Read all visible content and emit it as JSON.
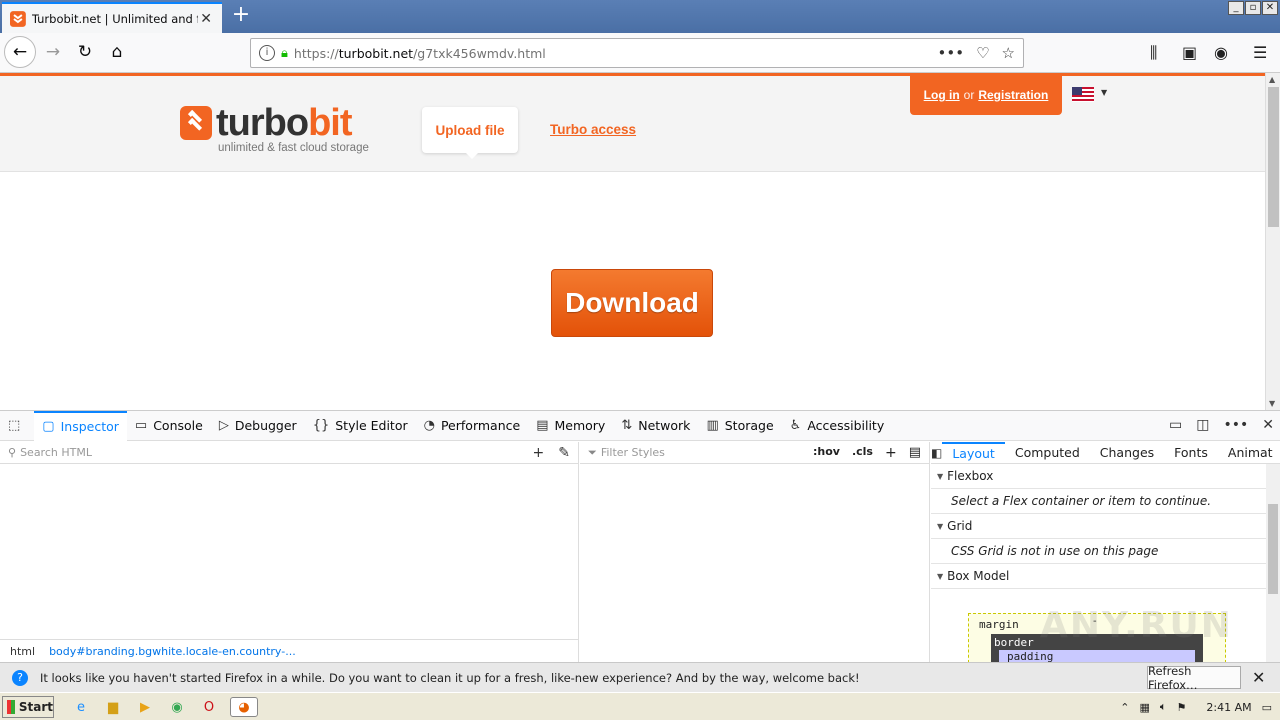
{
  "browser": {
    "tab_title": "Turbobit.net | Unlimited and fast fi",
    "url_prefix": "https://",
    "url_domain": "turbobit.net",
    "url_path": "/g7txk456wmdv.html",
    "window_controls": [
      "_",
      "▫",
      "X"
    ]
  },
  "page": {
    "logo_turbo": "turbo",
    "logo_bit": "bit",
    "tagline": "unlimited & fast cloud storage",
    "upload_label": "Upload file",
    "turbo_access_label": "Turbo access",
    "login_label": "Log in",
    "or_label": "or",
    "register_label": "Registration",
    "download_label": "Download"
  },
  "devtools": {
    "tabs": [
      "Inspector",
      "Console",
      "Debugger",
      "Style Editor",
      "Performance",
      "Memory",
      "Network",
      "Storage",
      "Accessibility"
    ],
    "search_html_placeholder": "Search HTML",
    "filter_styles_placeholder": "Filter Styles",
    "hov": ":hov",
    "cls": ".cls",
    "breadcrumb_root": "html",
    "breadcrumb_node": "body#branding.bgwhite.locale-en.country-...",
    "right_tabs": [
      "Layout",
      "Computed",
      "Changes",
      "Fonts",
      "Animat"
    ],
    "flexbox_title": "Flexbox",
    "flexbox_msg": "Select a Flex container or item to continue.",
    "grid_title": "Grid",
    "grid_msg": "CSS Grid is not in use on this page",
    "boxmodel_title": "Box Model",
    "bm_margin": "margin",
    "bm_border": "border",
    "bm_padding": "padding",
    "bm_dash": "-"
  },
  "notification": {
    "message": "It looks like you haven't started Firefox in a while. Do you want to clean it up for a fresh, like-new experience? And by the way, welcome back!",
    "button": "Refresh Firefox…"
  },
  "taskbar": {
    "start_label": "Start",
    "time": "2:41 AM"
  },
  "watermark": "ANY.RUN",
  "colors": {
    "brand": "#f26522",
    "devtools_accent": "#0a84ff"
  }
}
